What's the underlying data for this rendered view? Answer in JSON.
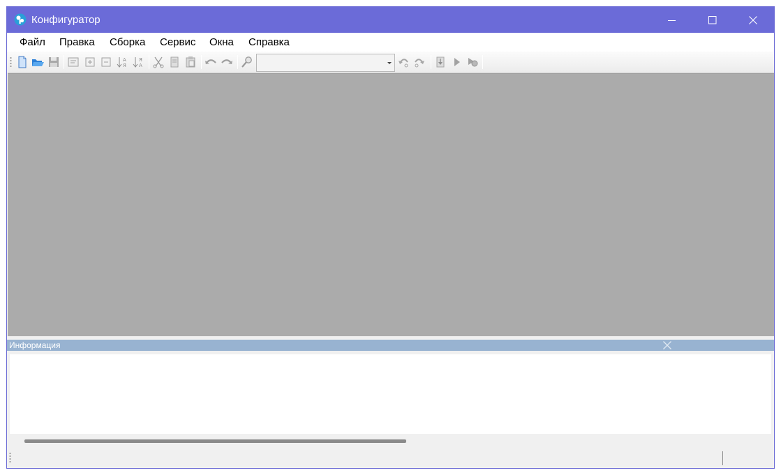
{
  "window": {
    "title": "Конфигуратор",
    "accent_color": "#6b6bd8",
    "controls": [
      "minimize-icon",
      "maximize-icon",
      "close-icon"
    ]
  },
  "menu": {
    "items": [
      "Файл",
      "Правка",
      "Сборка",
      "Сервис",
      "Окна",
      "Справка"
    ]
  },
  "toolbar": {
    "buttons": [
      {
        "name": "new-document-icon",
        "enabled": true
      },
      {
        "name": "open-folder-icon",
        "enabled": true
      },
      {
        "name": "save-icon",
        "enabled": false
      },
      {
        "name": "properties-icon",
        "enabled": false
      },
      {
        "name": "expand-icon",
        "enabled": false
      },
      {
        "name": "collapse-icon",
        "enabled": false
      },
      {
        "name": "sort-ascending-icon",
        "enabled": false
      },
      {
        "name": "sort-descending-icon",
        "enabled": false
      },
      {
        "name": "cut-icon",
        "enabled": false
      },
      {
        "name": "copy-icon",
        "enabled": false
      },
      {
        "name": "paste-icon",
        "enabled": false
      },
      {
        "name": "undo-icon",
        "enabled": false
      },
      {
        "name": "redo-icon",
        "enabled": false
      },
      {
        "name": "search-icon",
        "enabled": false
      },
      {
        "name": "find-previous-icon",
        "enabled": false
      },
      {
        "name": "find-next-icon",
        "enabled": false
      },
      {
        "name": "download-icon",
        "enabled": false
      },
      {
        "name": "run-icon",
        "enabled": false
      },
      {
        "name": "debug-icon",
        "enabled": false
      }
    ],
    "search_combo": {
      "value": ""
    }
  },
  "info_panel": {
    "title": "Информация",
    "header_color": "#98b3d1"
  },
  "workspace": {
    "background_color": "#ababab"
  },
  "scrollbar": {
    "thumb_fraction": 0.52
  }
}
